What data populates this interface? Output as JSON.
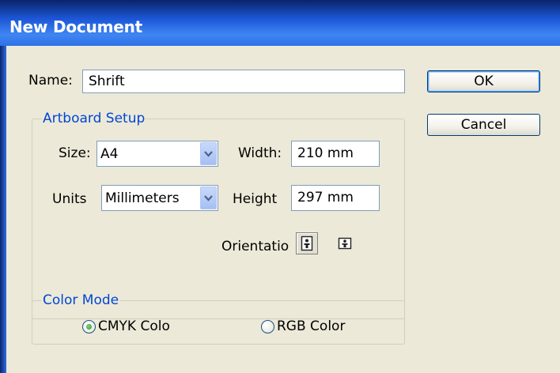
{
  "window": {
    "title": "New Document"
  },
  "name_field": {
    "label": "Name:",
    "value": "Shrift"
  },
  "buttons": {
    "ok_label": "OK",
    "cancel_label": "Cancel"
  },
  "artboard": {
    "legend": "Artboard Setup",
    "size_label": "Size:",
    "size_value": "A4",
    "units_label": "Units",
    "units_value": "Millimeters",
    "width_label": "Width:",
    "width_value": "210 mm",
    "height_label": "Height",
    "height_value": "297 mm",
    "orientation_label": "Orientatio",
    "orientation_options": [
      {
        "icon": "portrait-icon",
        "selected": true
      },
      {
        "icon": "landscape-icon",
        "selected": false
      }
    ]
  },
  "color_mode": {
    "legend": "Color Mode",
    "options": [
      {
        "label": "CMYK Colo",
        "selected": true
      },
      {
        "label": "RGB Color",
        "selected": false
      }
    ]
  },
  "colors": {
    "title_bar": "#1C57D8",
    "dialog_bg": "#ECE9D8",
    "group_legend": "#0046D5",
    "radio_selected": "#21A121"
  }
}
